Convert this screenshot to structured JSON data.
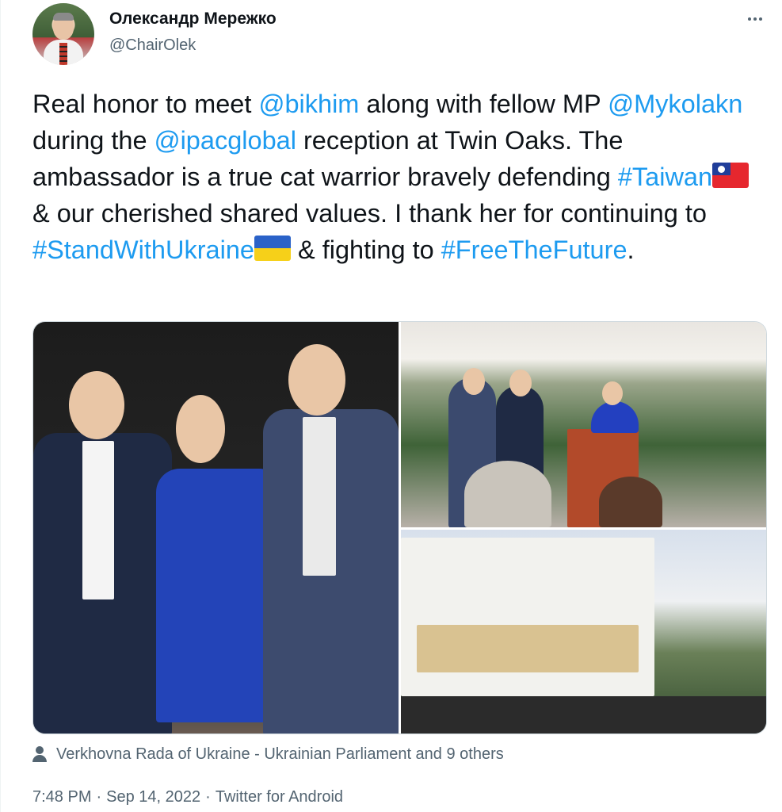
{
  "author": {
    "name": "Олександр Мережко",
    "handle": "@ChairOlek"
  },
  "tweet": {
    "seg1": "Real honor to meet ",
    "mention1": "@bikhim",
    "seg2": " along with fellow MP ",
    "mention2": "@Mykolakn",
    "seg3": " during the ",
    "mention3": "@ipacglobal",
    "seg4": " reception at Twin Oaks. The ambassador is a true cat warrior bravely defending ",
    "hashtag1": "#Taiwan",
    "seg5": " & our cherished shared values. I thank her for continuing to ",
    "hashtag2": "#StandWithUkraine",
    "seg6": " & fighting to ",
    "hashtag3": "#FreeTheFuture",
    "seg7": "."
  },
  "icons": {
    "more": "more-horizontal-icon",
    "tagged": "person-icon",
    "flag_taiwan": "taiwan-flag-icon",
    "flag_ukraine": "ukraine-flag-icon"
  },
  "colors": {
    "link": "#1d9bf0",
    "text": "#0f1419",
    "secondary": "#536471"
  },
  "media": {
    "tagged_text": "Verkhovna Rada of Ukraine - Ukrainian Parliament and 9 others",
    "photo_count": 3
  },
  "meta": {
    "time": "7:48 PM",
    "date": "Sep 14, 2022",
    "source": "Twitter for Android",
    "separator": "·"
  }
}
